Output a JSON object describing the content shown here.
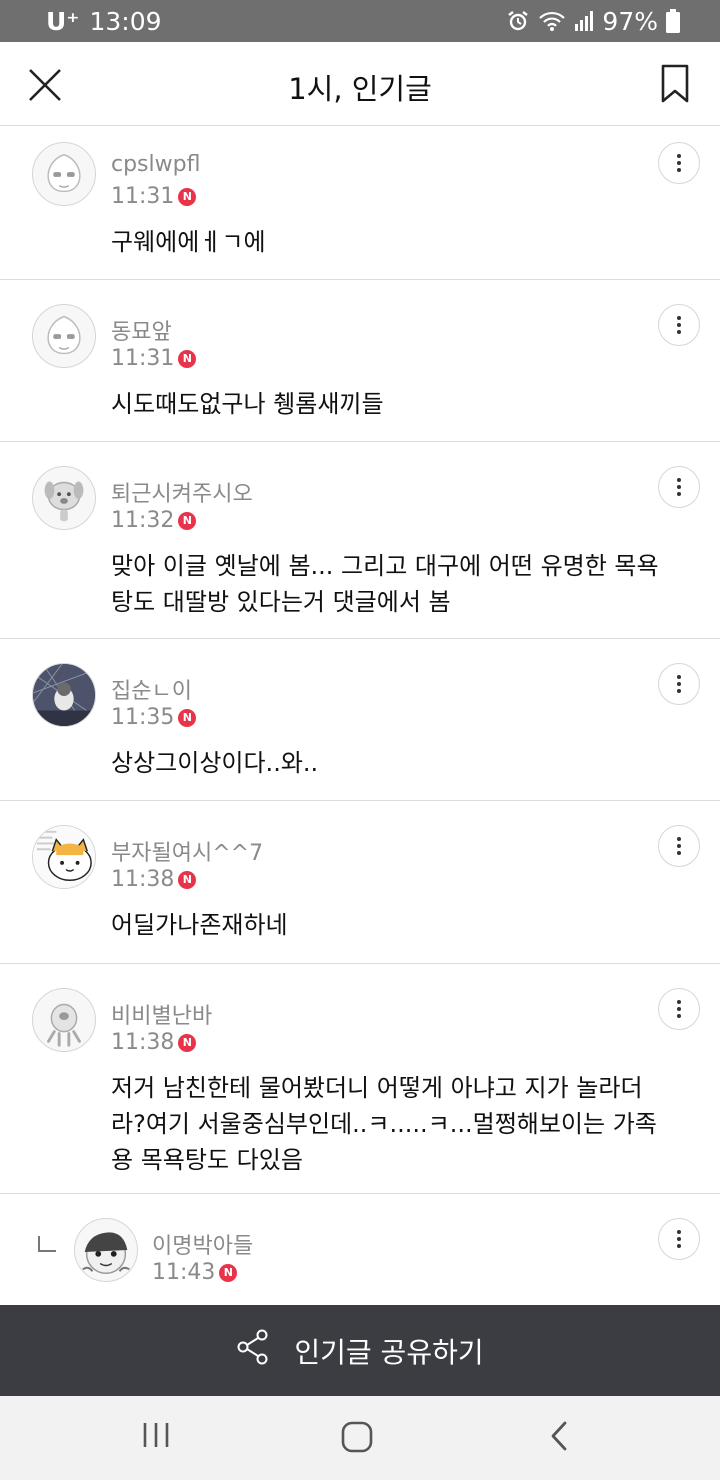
{
  "status": {
    "carrier": "U⁺",
    "time": "13:09",
    "battery": "97%"
  },
  "header": {
    "title": "1시, 인기글"
  },
  "comments": [
    {
      "username": "cpslwpfl",
      "time": "11:31",
      "badge": "N",
      "lines": [
        "구웨에에ㅔㄱ에"
      ]
    },
    {
      "username": "동묘앞",
      "time": "11:31",
      "badge": "N",
      "lines": [
        "시도때도없구나 췡롬새끼들"
      ]
    },
    {
      "username": "퇴근시켜주시오",
      "time": "11:32",
      "badge": "N",
      "lines": [
        "맞아 이글 옛날에 봄... 그리고 대구에 어떤 유명한 목욕",
        "탕도 대딸방 있다는거 댓글에서 봄"
      ]
    },
    {
      "username": "집순ㄴ이",
      "time": "11:35",
      "badge": "N",
      "lines": [
        "상상그이상이다..와.."
      ]
    },
    {
      "username": "부자될여시^^7",
      "time": "11:38",
      "badge": "N",
      "lines": [
        "어딜가나존재하네"
      ]
    },
    {
      "username": "비비별난바",
      "time": "11:38",
      "badge": "N",
      "lines": [
        "저거 남친한테 물어봤더니 어떻게 아냐고 지가 놀라더",
        "라?여기 서울중심부인데..ㅋ.....ㅋ...멀쩡해보이는 가족",
        "용 목욕탕도 다있음"
      ]
    },
    {
      "username": "이명박아들",
      "time": "11:43",
      "badge": "N",
      "lines": []
    }
  ],
  "share_bar": {
    "label": "인기글 공유하기"
  },
  "icons": {
    "close": "close-icon",
    "bookmark": "bookmark-icon",
    "more": "more-vertical-icon",
    "share": "share-icon",
    "alarm": "alarm-icon",
    "wifi": "wifi-icon",
    "signal": "signal-icon",
    "battery": "battery-icon",
    "recents": "recents-icon",
    "home": "home-icon",
    "back": "back-icon"
  },
  "colors": {
    "status_bar": "#6f6f6f",
    "share_bar": "#3b3d42",
    "new_badge": "#e8344b",
    "meta_text": "#8a8a8a"
  }
}
